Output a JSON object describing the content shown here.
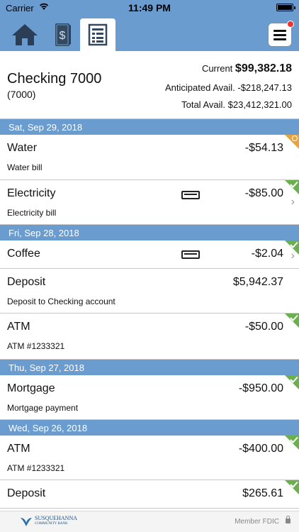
{
  "status_bar": {
    "carrier": "Carrier",
    "time": "11:49 PM"
  },
  "account": {
    "name": "Checking 7000",
    "number": "(7000)",
    "current_label": "Current",
    "current_value": "$99,382.18",
    "anticipated": "Anticipated Avail. -$218,247.13",
    "total": "Total Avail. $23,412,321.00"
  },
  "transactions": {
    "d1": "Sat, Sep 29, 2018",
    "t1": {
      "desc": "Water",
      "amount": "-$54.13",
      "memo": "Water bill"
    },
    "t2": {
      "desc": "Electricity",
      "amount": "-$85.00",
      "memo": "Electricity bill"
    },
    "d2": "Fri, Sep 28, 2018",
    "t3": {
      "desc": "Coffee",
      "amount": "-$2.04",
      "memo": ""
    },
    "t4": {
      "desc": "Deposit",
      "amount": "$5,942.37",
      "memo": "Deposit to Checking account"
    },
    "t5": {
      "desc": "ATM",
      "amount": "-$50.00",
      "memo": "ATM #1233321"
    },
    "d3": "Thu, Sep 27, 2018",
    "t6": {
      "desc": "Mortgage",
      "amount": "-$950.00",
      "memo": "Mortgage payment"
    },
    "d4": "Wed, Sep 26, 2018",
    "t7": {
      "desc": "ATM",
      "amount": "-$400.00",
      "memo": "ATM #1233321"
    },
    "t8": {
      "desc": "Deposit",
      "amount": "$265.61",
      "memo": ""
    }
  },
  "footer": {
    "logo_line1": "SUSQUEHANNA",
    "logo_line2": "COMMUNITY BANK",
    "fdic": "Member FDIC"
  },
  "icons": {
    "home": "home-icon",
    "money": "money-icon",
    "register": "register-icon",
    "menu": "hamburger-menu-icon",
    "cleared": "checkmark-icon",
    "pending": "clock-icon",
    "card": "card-icon",
    "chevron": "chevron-right-icon"
  },
  "colors": {
    "bar": "#6b9ccf",
    "cleared": "#6ab04c",
    "pending": "#e8a33c"
  }
}
